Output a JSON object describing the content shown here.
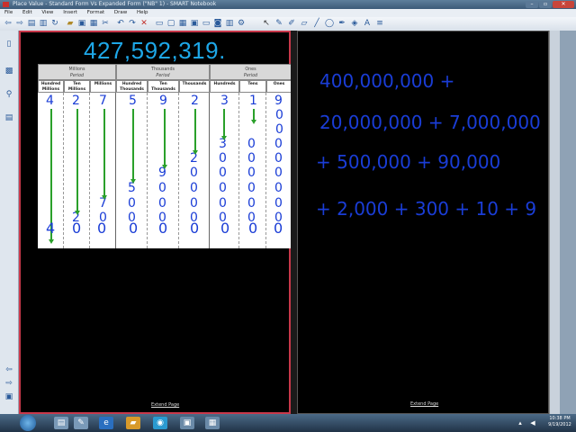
{
  "window": {
    "title": "Place Value - Standard Form Vs Expanded Form (\"NB\" 1) - SMART Notebook"
  },
  "menu": [
    "File",
    "Edit",
    "View",
    "Insert",
    "Format",
    "Draw",
    "Help"
  ],
  "page1": {
    "number": "427,592,319.",
    "periods": [
      {
        "name": "Millions",
        "sub": "Period"
      },
      {
        "name": "Thousands",
        "sub": "Period"
      },
      {
        "name": "Ones",
        "sub": "Period"
      }
    ],
    "columns": [
      {
        "line1": "Hundred",
        "line2": "Millions"
      },
      {
        "line1": "Ten",
        "line2": "Millions"
      },
      {
        "line1": "Millions",
        "line2": ""
      },
      {
        "line1": "Hundred",
        "line2": "Thousands"
      },
      {
        "line1": "Ten",
        "line2": "Thousands"
      },
      {
        "line1": "Thousands",
        "line2": ""
      },
      {
        "line1": "Hundreds",
        "line2": ""
      },
      {
        "line1": "Tens",
        "line2": ""
      },
      {
        "line1": "Ones",
        "line2": ""
      }
    ],
    "handwriting": {
      "top_digits": [
        "4",
        "2",
        "7",
        "5",
        "9",
        "2",
        "3",
        "1",
        "9"
      ],
      "row_1": "0",
      "row_2": "0",
      "row_3": [
        "3",
        "0",
        "0"
      ],
      "row_4": [
        "2",
        "0",
        "0",
        "0"
      ],
      "row_5": [
        "9",
        "0",
        "0",
        "0",
        "0"
      ],
      "row_6": [
        "5",
        "0",
        "0",
        "0",
        "0",
        "0"
      ],
      "row_7": [
        "7",
        "0",
        "0",
        "0",
        "0",
        "0",
        "0"
      ],
      "row_8": [
        "2",
        "0",
        "0",
        "0",
        "0",
        "0",
        "0",
        "0"
      ],
      "bottom_row": [
        "4",
        "0",
        "0",
        "0",
        "0",
        "0",
        "0",
        "0",
        "0"
      ]
    },
    "extend_label": "Extend Page"
  },
  "page2": {
    "lines": [
      "400,000,000 +",
      "20,000,000 + 7,000,000",
      "+ 500,000 + 90,000",
      "+ 2,000 + 300 + 10 + 9"
    ],
    "extend_label": "Extend Page"
  },
  "taskbar": {
    "time": "10:38 PM",
    "date": "9/19/2012"
  }
}
